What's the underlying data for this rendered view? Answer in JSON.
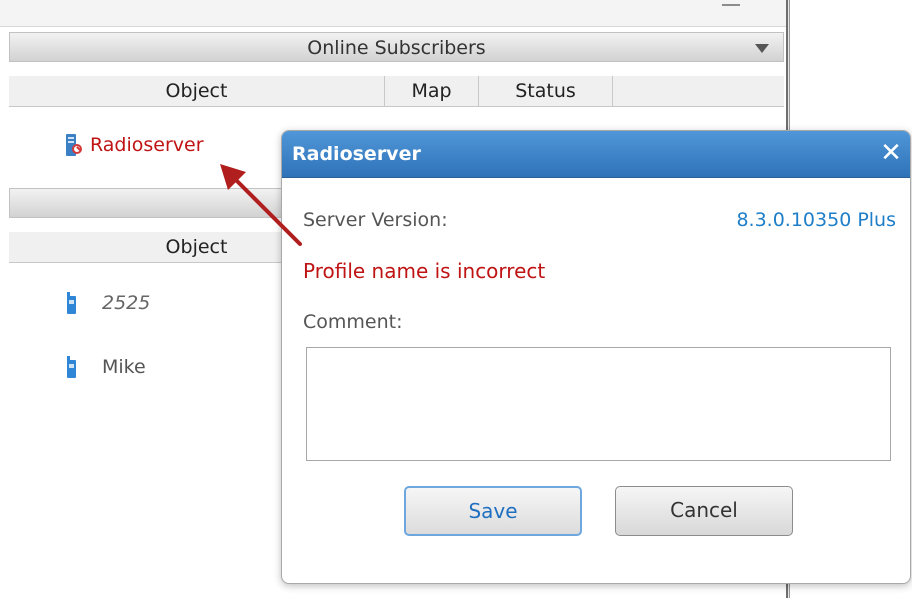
{
  "panel": {
    "online_title": "Online Subscribers",
    "columns": [
      "Object",
      "Map",
      "Status"
    ],
    "server_item": "Radioserver",
    "second_columns": [
      "Object"
    ],
    "subscribers": [
      {
        "label": "2525",
        "italic": true
      },
      {
        "label": "Mike",
        "italic": false
      }
    ]
  },
  "dialog": {
    "title": "Radioserver",
    "close_icon": "close-icon",
    "server_version_label": "Server Version:",
    "server_version_value": "8.3.0.10350 Plus",
    "error": "Profile name is incorrect",
    "comment_label": "Comment:",
    "comment_value": "",
    "save_label": "Save",
    "cancel_label": "Cancel"
  },
  "colors": {
    "error_red": "#c01313",
    "accent_blue": "#1e7fc8",
    "titlebar_blue": "#2f72b8",
    "arrow_red": "#b01e1e"
  }
}
